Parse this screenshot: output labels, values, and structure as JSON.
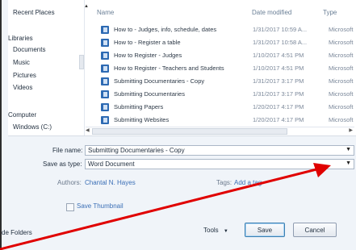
{
  "nav": {
    "items": [
      "Recent Places",
      "Libraries",
      "Documents",
      "Music",
      "Pictures",
      "Videos",
      "Computer",
      "Windows (C:)"
    ]
  },
  "columns": {
    "name": "Name",
    "date": "Date modified",
    "type": "Type"
  },
  "files": [
    {
      "name": "How to - Judges, info, schedule, dates",
      "date": "1/31/2017 10:59 A...",
      "type": "Microsoft"
    },
    {
      "name": "How to - Register a table",
      "date": "1/31/2017 10:58 A...",
      "type": "Microsoft"
    },
    {
      "name": "How to Register - Judges",
      "date": "1/10/2017 4:51 PM",
      "type": "Microsoft"
    },
    {
      "name": "How to Register - Teachers and Students",
      "date": "1/10/2017 4:51 PM",
      "type": "Microsoft"
    },
    {
      "name": "Submitting Documentaries - Copy",
      "date": "1/31/2017 3:17 PM",
      "type": "Microsoft"
    },
    {
      "name": "Submitting Documentaries",
      "date": "1/31/2017 3:17 PM",
      "type": "Microsoft"
    },
    {
      "name": "Submitting Papers",
      "date": "1/20/2017 4:17 PM",
      "type": "Microsoft"
    },
    {
      "name": "Submitting Websites",
      "date": "1/20/2017 4:17 PM",
      "type": "Microsoft"
    }
  ],
  "form": {
    "file_name_label": "File name:",
    "file_name_value": "Submitting Documentaries - Copy",
    "save_type_label": "Save as type:",
    "save_type_value": "Word Document",
    "authors_label": "Authors:",
    "authors_value": "Chantal N. Hayes",
    "tags_label": "Tags:",
    "tags_value": "Add a tag",
    "thumbnail_label": "Save Thumbnail"
  },
  "footer": {
    "hide_folders": "de Folders",
    "tools_label": "Tools",
    "save_label": "Save",
    "cancel_label": "Cancel"
  },
  "annotation": {
    "arrow_color": "#e00000"
  }
}
